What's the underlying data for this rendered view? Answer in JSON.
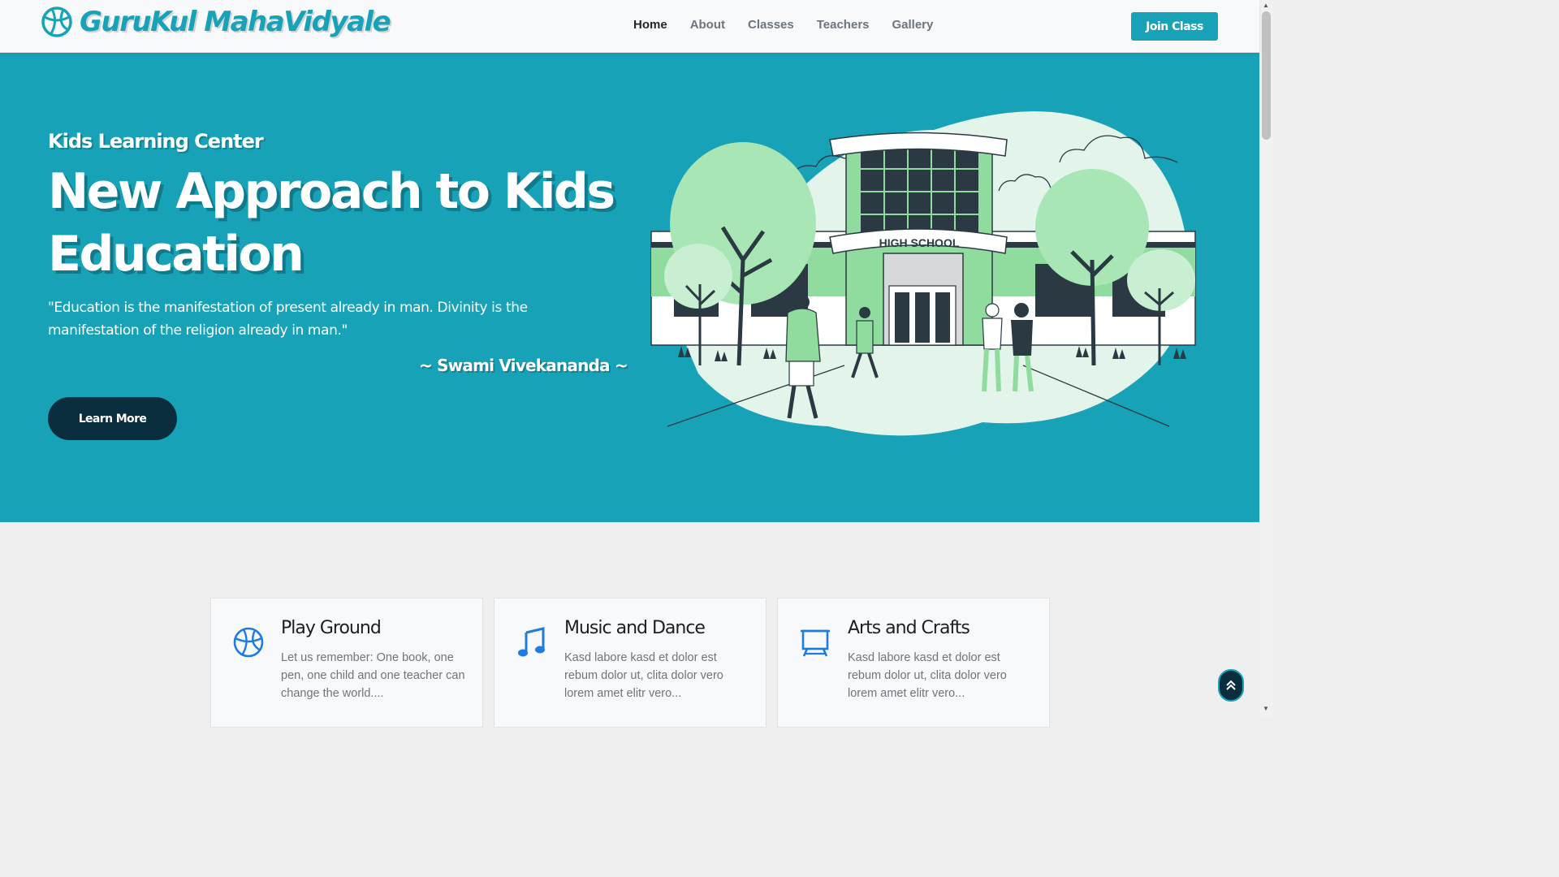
{
  "brand": {
    "name": "GuruKul MahaVidyale",
    "icon": "basketball-icon",
    "color": "#17a2b8"
  },
  "nav": {
    "items": [
      {
        "label": "Home",
        "active": true
      },
      {
        "label": "About",
        "active": false
      },
      {
        "label": "Classes",
        "active": false
      },
      {
        "label": "Teachers",
        "active": false
      },
      {
        "label": "Gallery",
        "active": false
      }
    ],
    "cta": "Join Class"
  },
  "hero": {
    "subtitle": "Kids Learning Center",
    "title": "New Approach to Kids Education",
    "quote": "\"Education is the manifestation of present already in man. Divinity is the manifestation of the religion already in man.\"",
    "author": "~ Swami Vivekananda ~",
    "button": "Learn More",
    "background": "#17a2b8",
    "illustration": {
      "sign": "HIGH SCHOOL"
    }
  },
  "features": [
    {
      "icon": "basketball-icon",
      "title": "Play Ground",
      "text": "Let us remember: One book, one pen, one child and one teacher can change the world...."
    },
    {
      "icon": "music-note-icon",
      "title": "Music and Dance",
      "text": "Kasd labore kasd et dolor est rebum dolor ut, clita dolor vero lorem amet elitr vero..."
    },
    {
      "icon": "easel-icon",
      "title": "Arts and Crafts",
      "text": "Kasd labore kasd et dolor est rebum dolor ut, clita dolor vero lorem amet elitr vero..."
    }
  ],
  "colors": {
    "primary": "#17a2b8",
    "dark": "#0b2e3f",
    "icon_blue": "#1e7be0"
  }
}
